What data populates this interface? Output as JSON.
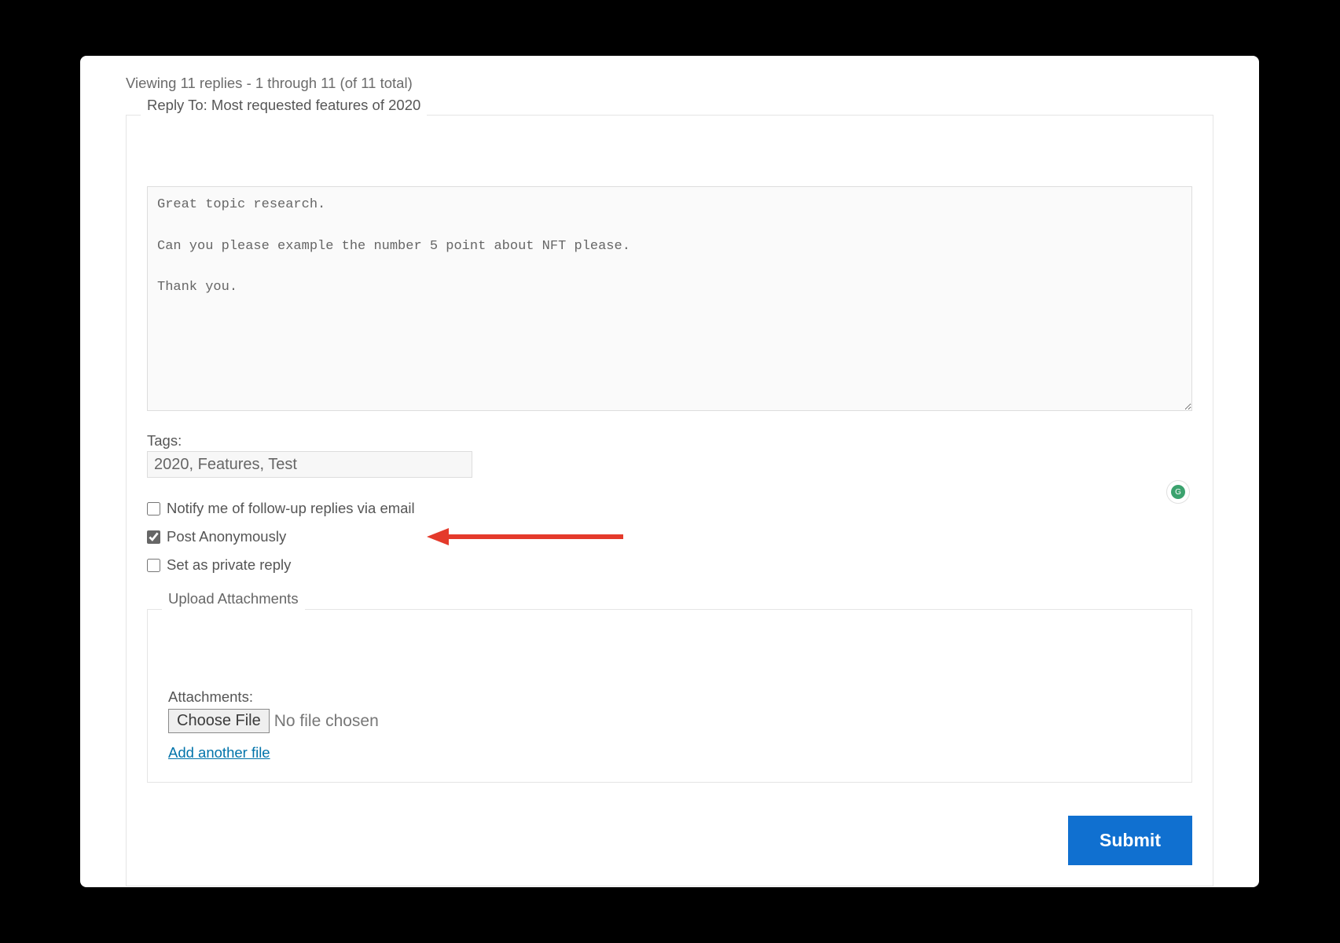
{
  "header": {
    "viewing_text": "Viewing 11 replies - 1 through 11 (of 11 total)"
  },
  "form": {
    "legend": "Reply To: Most requested features of 2020",
    "textarea_value": "Great topic research.\n\nCan you please example the number 5 point about NFT please.\n\nThank you.",
    "tags_label": "Tags:",
    "tags_value": "2020, Features, Test",
    "checkboxes": {
      "notify": {
        "label": "Notify me of follow-up replies via email",
        "checked": false
      },
      "anonymous": {
        "label": "Post Anonymously",
        "checked": true
      },
      "private": {
        "label": "Set as private reply",
        "checked": false
      }
    },
    "upload": {
      "legend": "Upload Attachments",
      "attachments_label": "Attachments:",
      "choose_file_label": "Choose File",
      "no_file_text": "No file chosen",
      "add_another_label": "Add another file"
    },
    "submit_label": "Submit"
  },
  "annotation": {
    "arrow_color": "#e43a2b"
  }
}
